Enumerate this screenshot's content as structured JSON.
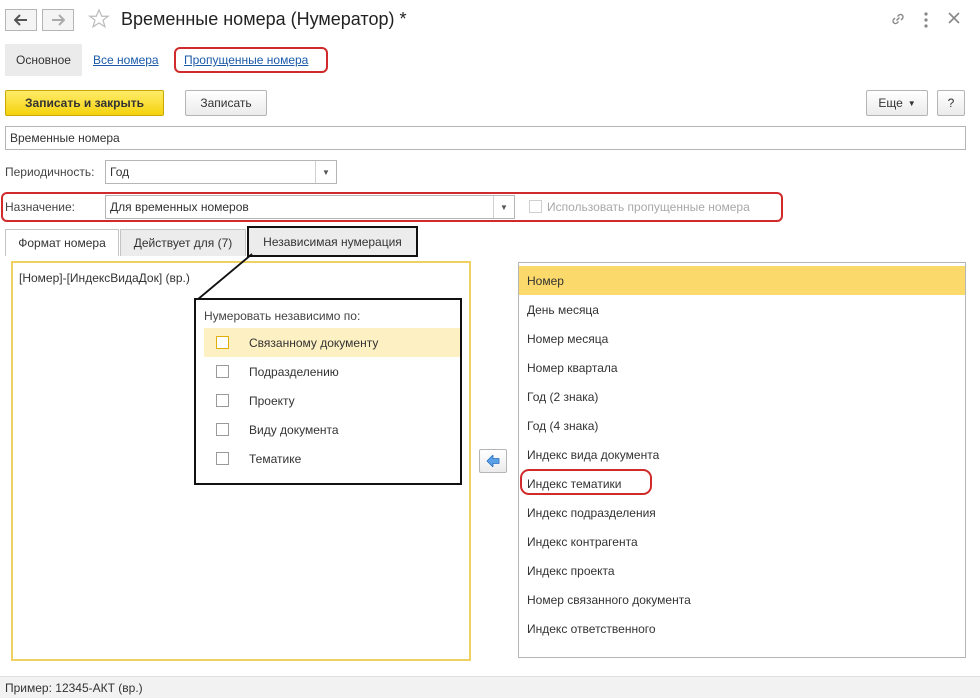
{
  "header": {
    "title": "Временные номера (Нумератор) *"
  },
  "topnav": {
    "main": "Основное",
    "all_numbers": "Все номера",
    "skipped_numbers": "Пропущенные номера"
  },
  "toolbar": {
    "save_close": "Записать и закрыть",
    "save": "Записать",
    "more": "Еще",
    "help": "?"
  },
  "form": {
    "name_value": "Временные номера",
    "periodicity_label": "Периодичность:",
    "periodicity_value": "Год",
    "purpose_label": "Назначение:",
    "purpose_value": "Для временных номеров",
    "use_skipped_label": "Использовать пропущенные номера"
  },
  "tabs": {
    "format": "Формат номера",
    "applies": "Действует для (7)",
    "independent": "Независимая нумерация"
  },
  "format_text": "[Номер]-[ИндексВидаДок] (вр.)",
  "independent_panel": {
    "title": "Нумеровать независимо по:",
    "items": [
      "Связанному документу",
      "Подразделению",
      "Проекту",
      "Виду документа",
      "Тематике"
    ]
  },
  "fields_list": [
    "Номер",
    "День месяца",
    "Номер месяца",
    "Номер квартала",
    "Год (2 знака)",
    "Год (4 знака)",
    "Индекс вида документа",
    "Индекс тематики",
    "Индекс подразделения",
    "Индекс контрагента",
    "Индекс проекта",
    "Номер связанного документа",
    "Индекс ответственного"
  ],
  "footer": {
    "example": "Пример:  12345-АКТ (вр.)"
  },
  "colors": {
    "accent_yellow": "#f5d20c",
    "selection": "#fbd96a",
    "link": "#1a5aa8",
    "highlight_red": "#d12a2a"
  }
}
